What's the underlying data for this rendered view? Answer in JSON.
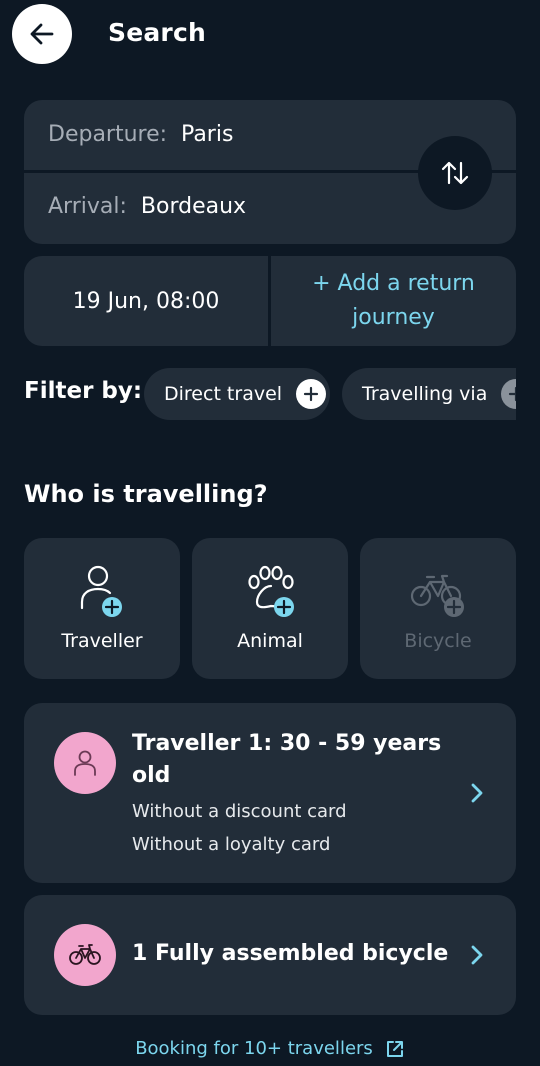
{
  "header": {
    "title": "Search"
  },
  "route": {
    "departure_label": "Departure:",
    "departure_value": "Paris",
    "arrival_label": "Arrival:",
    "arrival_value": "Bordeaux"
  },
  "dates": {
    "outbound": "19 Jun, 08:00",
    "return_label": "+ Add a return journey"
  },
  "filters": {
    "label": "Filter by:",
    "chips": [
      "Direct travel",
      "Travelling via"
    ]
  },
  "travellers_section": {
    "title": "Who is travelling?",
    "tiles": [
      {
        "label": "Traveller",
        "icon": "person-add-icon",
        "enabled": true
      },
      {
        "label": "Animal",
        "icon": "paw-add-icon",
        "enabled": true
      },
      {
        "label": "Bicycle",
        "icon": "bicycle-add-icon",
        "enabled": false
      }
    ]
  },
  "traveller_card": {
    "title": "Traveller 1: 30 - 59 years old",
    "line1": "Without a discount card",
    "line2": "Without a loyalty card"
  },
  "bicycle_card": {
    "title": "1 Fully assembled bicycle"
  },
  "footer": {
    "link": "Booking for 10+ travellers"
  },
  "colors": {
    "background": "#0d1824",
    "card": "#222d39",
    "accent": "#7cd6ee",
    "avatar": "#f2a6cd"
  }
}
